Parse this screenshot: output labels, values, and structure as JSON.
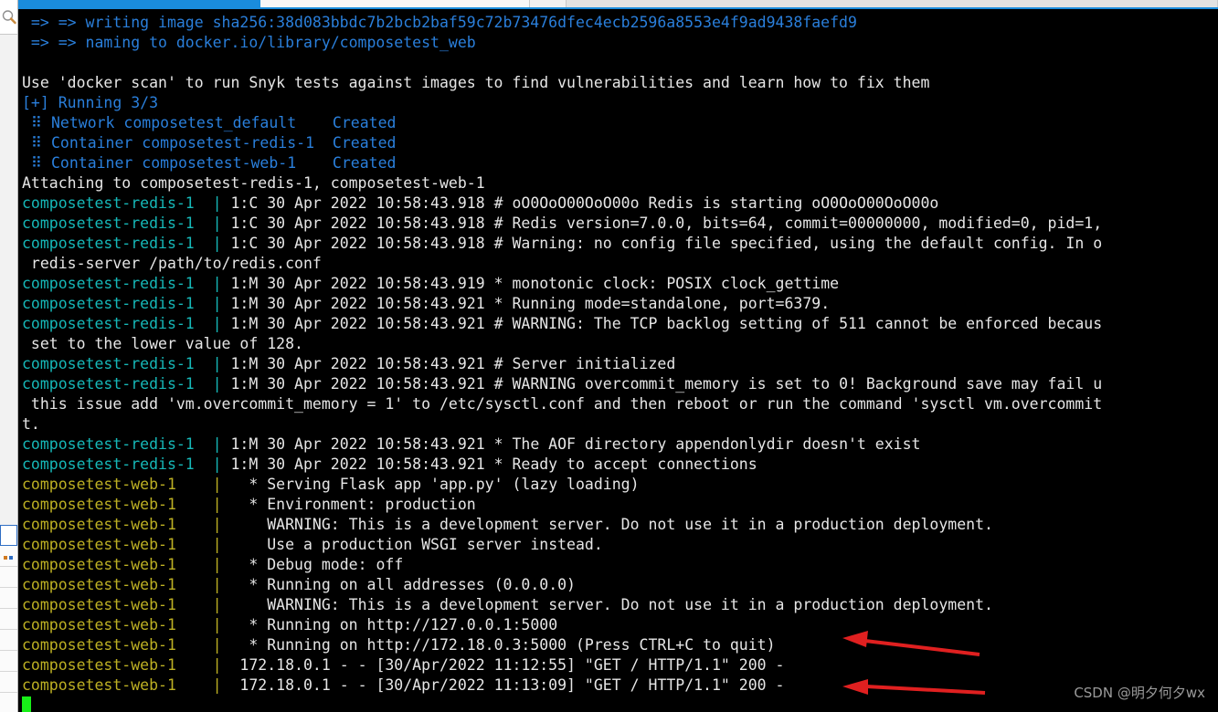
{
  "window": {
    "title": "docker compose up terminal output",
    "tabbar": {
      "active_tab_label": "",
      "segments": [
        "active",
        "plain",
        "plain2"
      ]
    },
    "sidebar": {
      "search_icon": "magnifier-icon",
      "row_count": 9
    }
  },
  "colors": {
    "background": "#000000",
    "default_text": "#d8d8d8",
    "blue": "#2a7fdb",
    "teal": "#16b8b8",
    "yellow": "#bdb023",
    "arrow_red": "#e02020",
    "cursor_green": "#18ef18",
    "tab_active": "#1a8cdc",
    "watermark": "#9a9a9a"
  },
  "terminal": {
    "lines": [
      {
        "id": "l01",
        "segments": [
          {
            "text": " => => writing image sha256:38d083bbdc7b2bcb2baf59c72b73476dfec4ecb2596a8553e4f9ad9438faefd9",
            "color": "blue"
          }
        ]
      },
      {
        "id": "l02",
        "segments": [
          {
            "text": " => => naming to docker.io/library/composetest_web",
            "color": "blue"
          }
        ]
      },
      {
        "id": "l03",
        "segments": [
          {
            "text": "",
            "color": "white"
          }
        ]
      },
      {
        "id": "l04",
        "segments": [
          {
            "text": "Use 'docker scan' to run Snyk tests against images to find vulnerabilities and learn how to fix them",
            "color": "white"
          }
        ]
      },
      {
        "id": "l05",
        "segments": [
          {
            "text": "[+] Running 3/3",
            "color": "blue"
          }
        ]
      },
      {
        "id": "l06",
        "segments": [
          {
            "text": " ⠿ Network composetest_default    Created",
            "color": "blue"
          }
        ]
      },
      {
        "id": "l07",
        "segments": [
          {
            "text": " ⠿ Container composetest-redis-1  Created",
            "color": "blue"
          }
        ]
      },
      {
        "id": "l08",
        "segments": [
          {
            "text": " ⠿ Container composetest-web-1    Created",
            "color": "blue"
          }
        ]
      },
      {
        "id": "l09",
        "segments": [
          {
            "text": "Attaching to composetest-redis-1, composetest-web-1",
            "color": "white"
          }
        ]
      },
      {
        "id": "l10",
        "segments": [
          {
            "text": "composetest-redis-1",
            "color": "teal"
          },
          {
            "text": "  | ",
            "color": "teal"
          },
          {
            "text": "1:C 30 Apr 2022 10:58:43.918 # oO0OoO00OoO00o Redis is starting oO0OoO00OoO00o",
            "color": "white"
          }
        ]
      },
      {
        "id": "l11",
        "segments": [
          {
            "text": "composetest-redis-1",
            "color": "teal"
          },
          {
            "text": "  | ",
            "color": "teal"
          },
          {
            "text": "1:C 30 Apr 2022 10:58:43.918 # Redis version=7.0.0, bits=64, commit=00000000, modified=0, pid=1,",
            "color": "white"
          }
        ]
      },
      {
        "id": "l12",
        "segments": [
          {
            "text": "composetest-redis-1",
            "color": "teal"
          },
          {
            "text": "  | ",
            "color": "teal"
          },
          {
            "text": "1:C 30 Apr 2022 10:58:43.918 # Warning: no config file specified, using the default config. In o",
            "color": "white"
          }
        ]
      },
      {
        "id": "l13",
        "segments": [
          {
            "text": " redis-server /path/to/redis.conf",
            "color": "white"
          }
        ]
      },
      {
        "id": "l14",
        "segments": [
          {
            "text": "composetest-redis-1",
            "color": "teal"
          },
          {
            "text": "  | ",
            "color": "teal"
          },
          {
            "text": "1:M 30 Apr 2022 10:58:43.919 * monotonic clock: POSIX clock_gettime",
            "color": "white"
          }
        ]
      },
      {
        "id": "l15",
        "segments": [
          {
            "text": "composetest-redis-1",
            "color": "teal"
          },
          {
            "text": "  | ",
            "color": "teal"
          },
          {
            "text": "1:M 30 Apr 2022 10:58:43.921 * Running mode=standalone, port=6379.",
            "color": "white"
          }
        ]
      },
      {
        "id": "l16",
        "segments": [
          {
            "text": "composetest-redis-1",
            "color": "teal"
          },
          {
            "text": "  | ",
            "color": "teal"
          },
          {
            "text": "1:M 30 Apr 2022 10:58:43.921 # WARNING: The TCP backlog setting of 511 cannot be enforced becaus",
            "color": "white"
          }
        ]
      },
      {
        "id": "l17",
        "segments": [
          {
            "text": " set to the lower value of 128.",
            "color": "white"
          }
        ]
      },
      {
        "id": "l18",
        "segments": [
          {
            "text": "composetest-redis-1",
            "color": "teal"
          },
          {
            "text": "  | ",
            "color": "teal"
          },
          {
            "text": "1:M 30 Apr 2022 10:58:43.921 # Server initialized",
            "color": "white"
          }
        ]
      },
      {
        "id": "l19",
        "segments": [
          {
            "text": "composetest-redis-1",
            "color": "teal"
          },
          {
            "text": "  | ",
            "color": "teal"
          },
          {
            "text": "1:M 30 Apr 2022 10:58:43.921 # WARNING overcommit_memory is set to 0! Background save may fail u",
            "color": "white"
          }
        ]
      },
      {
        "id": "l20",
        "segments": [
          {
            "text": " this issue add 'vm.overcommit_memory = 1' to /etc/sysctl.conf and then reboot or run the command 'sysctl vm.overcommit",
            "color": "white"
          }
        ]
      },
      {
        "id": "l21",
        "segments": [
          {
            "text": "t.",
            "color": "white"
          }
        ]
      },
      {
        "id": "l22",
        "segments": [
          {
            "text": "composetest-redis-1",
            "color": "teal"
          },
          {
            "text": "  | ",
            "color": "teal"
          },
          {
            "text": "1:M 30 Apr 2022 10:58:43.921 * The AOF directory appendonlydir doesn't exist",
            "color": "white"
          }
        ]
      },
      {
        "id": "l23",
        "segments": [
          {
            "text": "composetest-redis-1",
            "color": "teal"
          },
          {
            "text": "  | ",
            "color": "teal"
          },
          {
            "text": "1:M 30 Apr 2022 10:58:43.921 * Ready to accept connections",
            "color": "white"
          }
        ]
      },
      {
        "id": "l24",
        "segments": [
          {
            "text": "composetest-web-1",
            "color": "yellow"
          },
          {
            "text": "    |  ",
            "color": "yellow"
          },
          {
            "text": " * Serving Flask app 'app.py' (lazy loading)",
            "color": "white"
          }
        ]
      },
      {
        "id": "l25",
        "segments": [
          {
            "text": "composetest-web-1",
            "color": "yellow"
          },
          {
            "text": "    |  ",
            "color": "yellow"
          },
          {
            "text": " * Environment: production",
            "color": "white"
          }
        ]
      },
      {
        "id": "l26",
        "segments": [
          {
            "text": "composetest-web-1",
            "color": "yellow"
          },
          {
            "text": "    |  ",
            "color": "yellow"
          },
          {
            "text": "   WARNING: This is a development server. Do not use it in a production deployment.",
            "color": "white"
          }
        ]
      },
      {
        "id": "l27",
        "segments": [
          {
            "text": "composetest-web-1",
            "color": "yellow"
          },
          {
            "text": "    |  ",
            "color": "yellow"
          },
          {
            "text": "   Use a production WSGI server instead.",
            "color": "white"
          }
        ]
      },
      {
        "id": "l28",
        "segments": [
          {
            "text": "composetest-web-1",
            "color": "yellow"
          },
          {
            "text": "    |  ",
            "color": "yellow"
          },
          {
            "text": " * Debug mode: off",
            "color": "white"
          }
        ]
      },
      {
        "id": "l29",
        "segments": [
          {
            "text": "composetest-web-1",
            "color": "yellow"
          },
          {
            "text": "    |  ",
            "color": "yellow"
          },
          {
            "text": " * Running on all addresses (0.0.0.0)",
            "color": "white"
          }
        ]
      },
      {
        "id": "l30",
        "segments": [
          {
            "text": "composetest-web-1",
            "color": "yellow"
          },
          {
            "text": "    |  ",
            "color": "yellow"
          },
          {
            "text": "   WARNING: This is a development server. Do not use it in a production deployment.",
            "color": "white"
          }
        ]
      },
      {
        "id": "l31",
        "segments": [
          {
            "text": "composetest-web-1",
            "color": "yellow"
          },
          {
            "text": "    |  ",
            "color": "yellow"
          },
          {
            "text": " * Running on http://127.0.0.1:5000",
            "color": "white"
          }
        ]
      },
      {
        "id": "l32",
        "segments": [
          {
            "text": "composetest-web-1",
            "color": "yellow"
          },
          {
            "text": "    |  ",
            "color": "yellow"
          },
          {
            "text": " * Running on http://172.18.0.3:5000 (Press CTRL+C to quit)",
            "color": "white"
          }
        ]
      },
      {
        "id": "l33",
        "segments": [
          {
            "text": "composetest-web-1",
            "color": "yellow"
          },
          {
            "text": "    | ",
            "color": "yellow"
          },
          {
            "text": " 172.18.0.1 - - [30/Apr/2022 11:12:55] \"GET / HTTP/1.1\" 200 -",
            "color": "white"
          }
        ]
      },
      {
        "id": "l34",
        "segments": [
          {
            "text": "composetest-web-1",
            "color": "yellow"
          },
          {
            "text": "    | ",
            "color": "yellow"
          },
          {
            "text": " 172.18.0.1 - - [30/Apr/2022 11:13:09] \"GET / HTTP/1.1\" 200 -",
            "color": "white"
          }
        ]
      }
    ],
    "cursor": {
      "visible": true,
      "shape": "block",
      "color": "#18ef18"
    }
  },
  "annotations": {
    "arrows": [
      {
        "id": "arrow-1",
        "points_to": "Running on http://172.18.0.3:5000 (Press CTRL+C to quit)",
        "color": "#e02020"
      },
      {
        "id": "arrow-2",
        "points_to": "172.18.0.1 - - [30/Apr/2022 11:13:09] \"GET / HTTP/1.1\" 200 -",
        "color": "#e02020"
      }
    ],
    "watermark": "CSDN @明夕何夕wx"
  }
}
